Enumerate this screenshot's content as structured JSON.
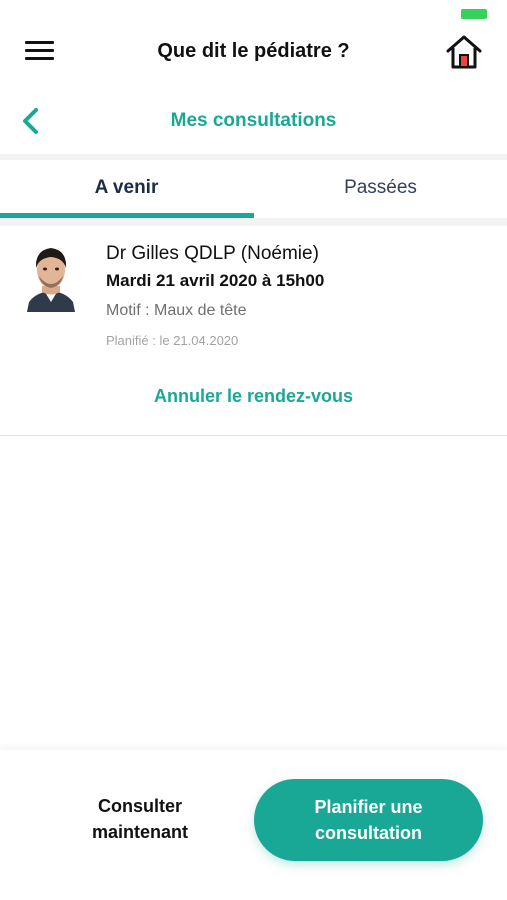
{
  "colors": {
    "accent": "#1aa896",
    "battery": "#35d15a",
    "title_dark": "#1d2b4a"
  },
  "header": {
    "title": "Que dit le pédiatre ?",
    "menu_icon": "hamburger-menu-icon",
    "home_icon": "home-icon"
  },
  "subheader": {
    "title": "Mes consultations",
    "back_icon": "chevron-left-icon"
  },
  "tabs": [
    {
      "label": "A venir",
      "active": true
    },
    {
      "label": "Passées",
      "active": false
    }
  ],
  "appointment": {
    "doctor": "Dr Gilles QDLP (Noémie)",
    "datetime": "Mardi 21 avril 2020 à 15h00",
    "motif": "Motif : Maux de tête",
    "planned": "Planifié : le 21.04.2020",
    "cancel_label": "Annuler le rendez-vous",
    "avatar_icon": "doctor-avatar"
  },
  "bottom": {
    "consult_now_line1": "Consulter",
    "consult_now_line2": "maintenant",
    "plan_line1": "Planifier une",
    "plan_line2": "consultation"
  }
}
